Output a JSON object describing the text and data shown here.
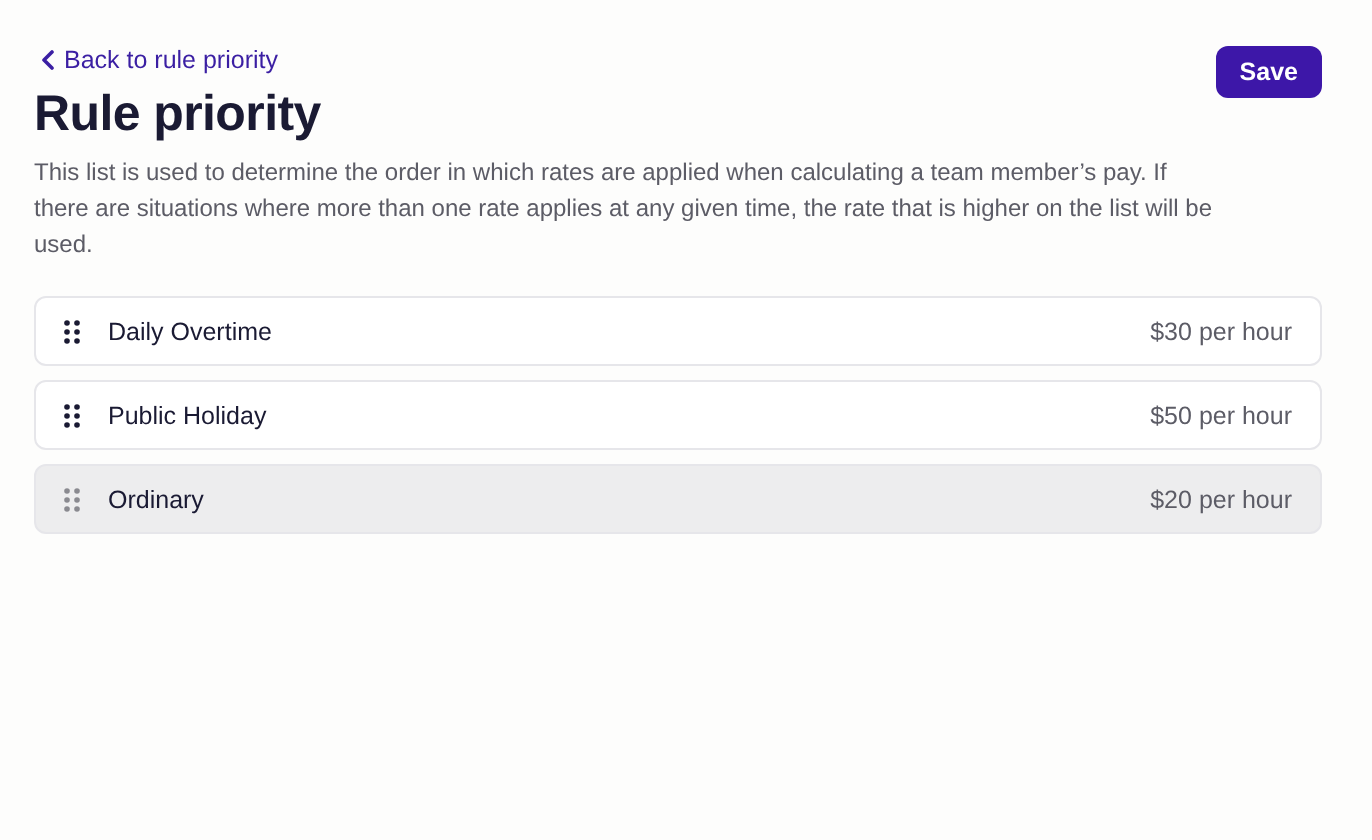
{
  "back_link": "Back to rule priority",
  "title": "Rule priority",
  "save_button": "Save",
  "description": "This list is used to determine the order in which rates are applied when calculating a team member’s pay. If there are situations where more than one rate applies at any given time, the rate that is higher on the list will be used.",
  "rules": [
    {
      "name": "Daily Overtime",
      "rate": "$30 per hour",
      "dragging": false
    },
    {
      "name": "Public Holiday",
      "rate": "$50 per hour",
      "dragging": false
    },
    {
      "name": "Ordinary",
      "rate": "$20 per hour",
      "dragging": true
    }
  ]
}
